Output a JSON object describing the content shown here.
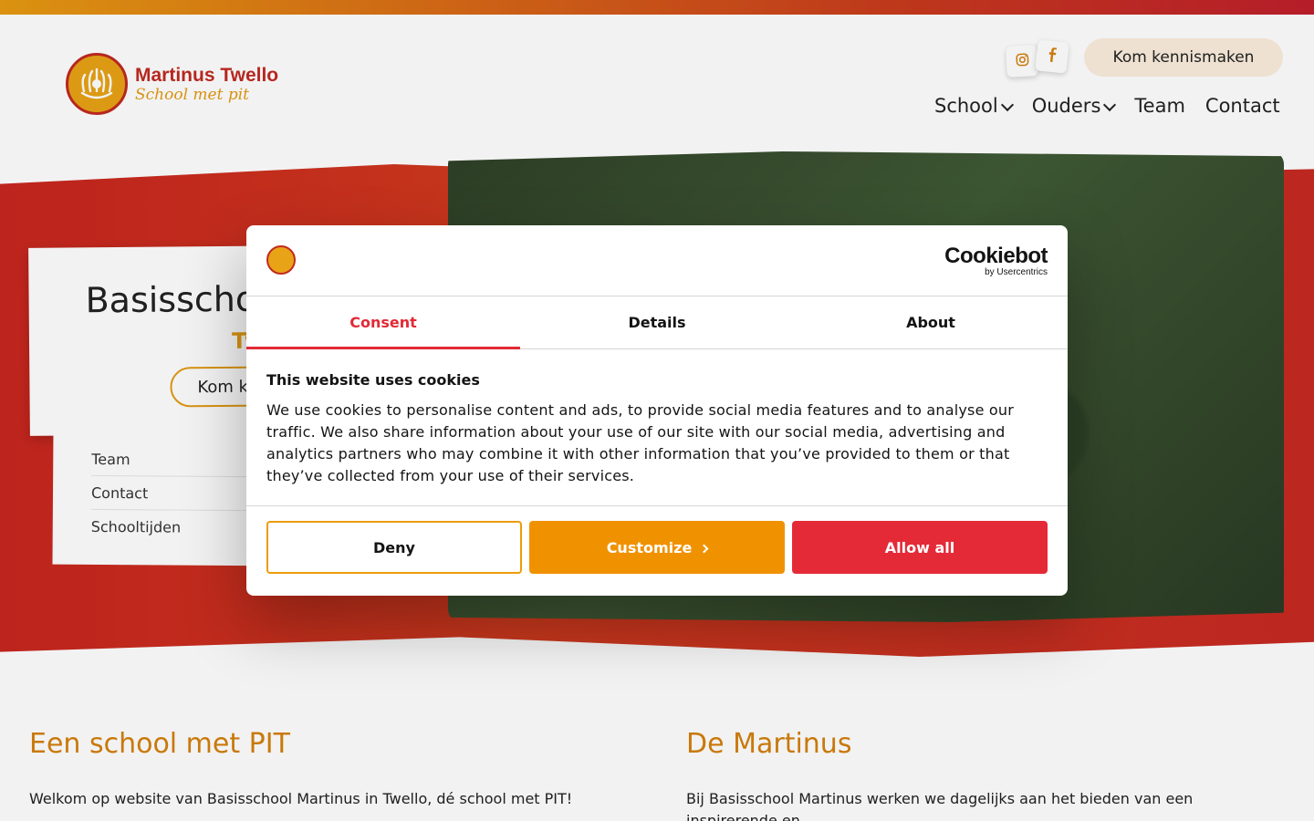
{
  "site": {
    "logo_title": "Martinus Twello",
    "logo_sub": "School met pit",
    "cta": "Kom kennismaken",
    "nav": [
      "School",
      "Ouders",
      "Team",
      "Contact"
    ]
  },
  "hero": {
    "title": "Basisschool Martinus",
    "subtitle": "Twello",
    "button": "Kom kennismaken",
    "quick_links": [
      "Team",
      "Contact",
      "Schooltijden"
    ]
  },
  "content": {
    "left_heading": "Een school met PIT",
    "left_text": "Welkom op website van Basisschool Martinus in Twello, dé school met PIT!",
    "right_heading": "De Martinus",
    "right_text": "Bij Basisschool Martinus werken we dagelijks aan het bieden van een inspirerende en"
  },
  "cookie": {
    "brand": "Cookiebot",
    "brand_by": "by Usercentrics",
    "tabs": [
      "Consent",
      "Details",
      "About"
    ],
    "title": "This website uses cookies",
    "text": "We use cookies to personalise content and ads, to provide social media features and to analyse our traffic. We also share information about your use of our site with our social media, advertising and analytics partners who may combine it with other information that you’ve provided to them or that they’ve collected from your use of their services.",
    "deny": "Deny",
    "customize": "Customize",
    "allow": "Allow all"
  },
  "colors": {
    "brand_red": "#c02a21",
    "brand_orange": "#e39a12",
    "cookie_red": "#e52a37",
    "cookie_orange": "#f09200"
  }
}
